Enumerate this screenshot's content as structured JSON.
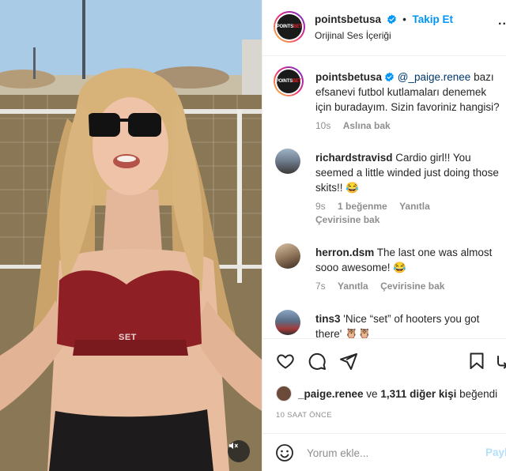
{
  "video": {
    "shirt_text": "SET",
    "mute_icon": "speaker-muted-icon"
  },
  "header": {
    "username": "pointsbetusa",
    "verified_icon": "verified-badge-icon",
    "dot": "•",
    "follow_label": "Takip Et",
    "audio_label": "Orijinal Ses İçeriği",
    "more_label": "...",
    "logo_part1": "POINTS",
    "logo_part2": "BET"
  },
  "caption": {
    "username": "pointsbetusa",
    "mention": "@_paige.renee",
    "text": " bazı efsanevi futbol kutlamaları denemek için buradayım. Sizin favoriniz hangisi?",
    "time": "10s",
    "see_translation": "Aslına bak"
  },
  "comments": [
    {
      "username": "richardstravisd",
      "text": " Cardio girl!! You seemed a little winded just doing those skits!! 😂",
      "time": "9s",
      "likes": "1 beğenme",
      "reply": "Yanıtla",
      "translation": "Çevirisine bak"
    },
    {
      "username": "herron.dsm",
      "text": " The last one was almost sooo awesome! 😂",
      "time": "7s",
      "reply": "Yanıtla",
      "translation": "Çevirisine bak"
    },
    {
      "username": "tins3",
      "text": " 'Nice “set” of hooters you got there' 🦉🦉"
    }
  ],
  "actions": {
    "like_icon": "heart-icon",
    "comment_icon": "comment-bubble-icon",
    "share_icon": "paper-plane-icon",
    "save_icon": "bookmark-icon"
  },
  "likes": {
    "first_user": "_paige.renee",
    "connector": " ve ",
    "others": "1,311 diğer kişi",
    "suffix": " beğendi"
  },
  "timeago": "10 SAAT ÖNCE",
  "comment_box": {
    "emoji_icon": "smiley-icon",
    "placeholder": "Yorum ekle...",
    "post_label": "Paylaş"
  },
  "colors": {
    "accent": "#0095f6",
    "mention": "#00376b",
    "muted": "#8e8e8e",
    "post_disabled": "#b2dffc",
    "shirt": "#8e1f24"
  }
}
